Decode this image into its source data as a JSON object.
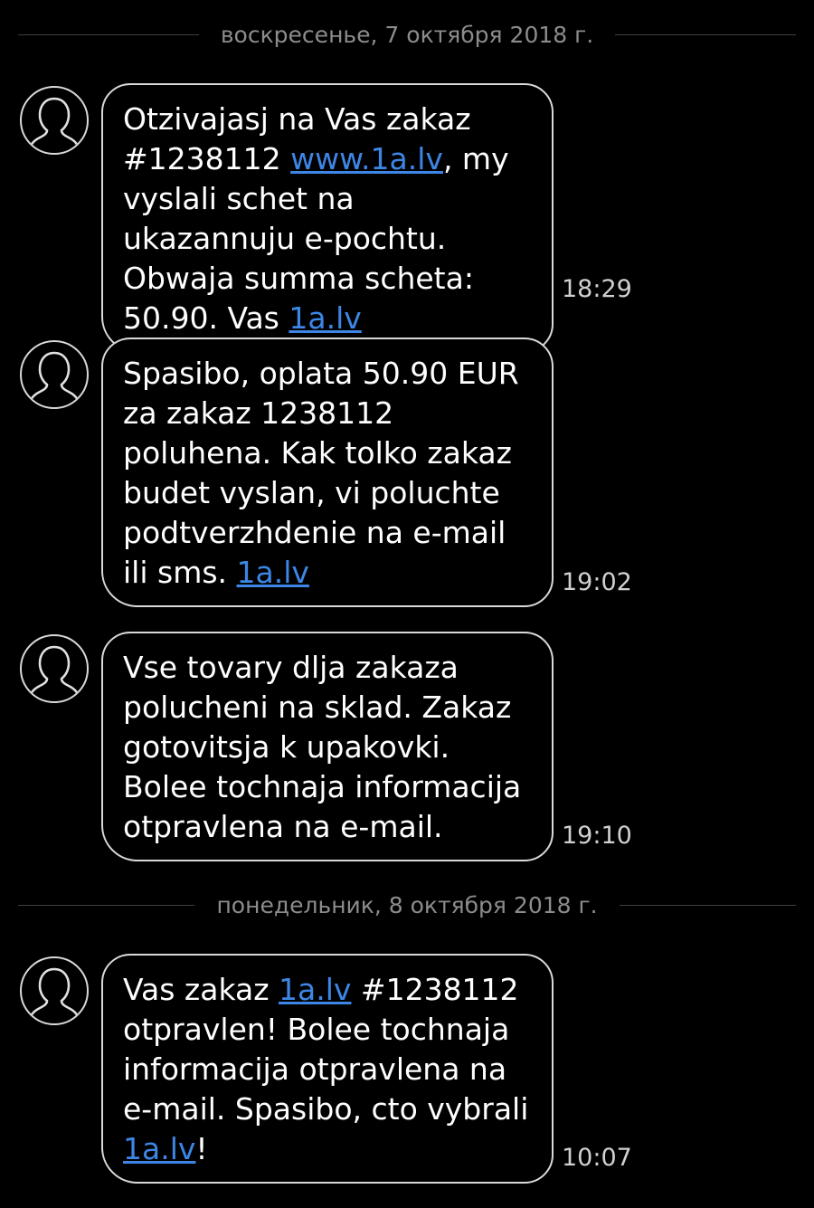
{
  "dates": [
    {
      "label": "воскресенье, 7 октября 2018 г."
    },
    {
      "label": "понедельник, 8 октября 2018 г."
    }
  ],
  "icons": {
    "avatar": "person-silhouette-icon"
  },
  "colors": {
    "background": "#000000",
    "link": "#3d86e6",
    "date_text": "#8c8c8c"
  },
  "messages": [
    {
      "time": "18:29",
      "parts": [
        {
          "text": "Otzivajasj na Vas zakaz #1238112 "
        },
        {
          "link": "www.1a.lv"
        },
        {
          "text": ", my vyslali schet na ukazannuju e-pochtu. Obwaja summa scheta: 50.90. Vas "
        },
        {
          "link": "1a.lv"
        }
      ]
    },
    {
      "time": "19:02",
      "parts": [
        {
          "text": "Spasibo, oplata 50.90 EUR za zakaz 1238112 poluhena. Kak tolko zakaz budet vyslan, vi poluchte podtverzhdenie na e-mail ili sms. "
        },
        {
          "link": "1a.lv"
        }
      ]
    },
    {
      "time": "19:10",
      "parts": [
        {
          "text": "Vse tovary dlja zakaza polucheni na sklad. Zakaz gotovitsja k upakovki. Bolee tochnaja informacija otpravlena na e-mail."
        }
      ]
    },
    {
      "time": "10:07",
      "parts": [
        {
          "text": "Vas zakaz "
        },
        {
          "link": "1a.lv"
        },
        {
          "text": " #1238112 otpravlen! Bolee tochnaja informacija otpravlena na e-mail. Spasibo, cto vybrali "
        },
        {
          "link": "1a.lv"
        },
        {
          "text": "!"
        }
      ]
    }
  ]
}
